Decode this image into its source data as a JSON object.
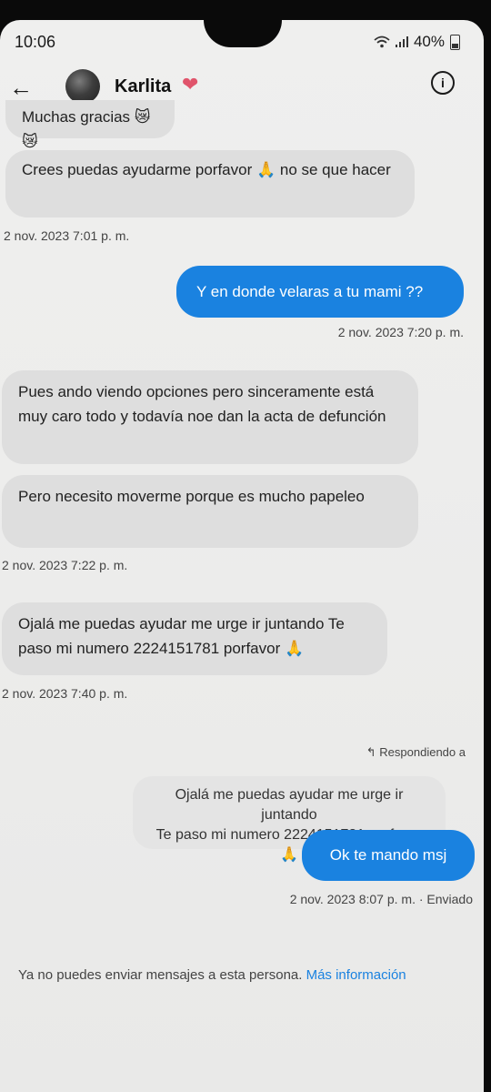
{
  "status_bar": {
    "time": "10:06",
    "battery": "40%"
  },
  "header": {
    "contact_name": "Karlita",
    "heart": "❤",
    "back_icon": "←",
    "info_icon": "i"
  },
  "messages": [
    {
      "dir": "in",
      "text": "Muchas gracias 😿😿"
    },
    {
      "dir": "in",
      "text": "Crees puedas ayudarme porfavor 🙏 no se que hacer"
    },
    {
      "dir": "time",
      "text": "2 nov. 2023 7:01 p. m."
    },
    {
      "dir": "out",
      "text": "Y en donde velaras a tu mami ??"
    },
    {
      "dir": "time",
      "text": "2 nov. 2023 7:20 p. m."
    },
    {
      "dir": "in",
      "text": "Pues ando viendo opciones pero sinceramente está muy caro todo y todavía noe dan la acta de defunción"
    },
    {
      "dir": "in",
      "text": "Pero necesito moverme porque es mucho papeleo"
    },
    {
      "dir": "time",
      "text": "2 nov. 2023 7:22 p. m."
    },
    {
      "dir": "in",
      "text": "Ojalá me puedas ayudar me urge ir juntando Te paso mi numero 2224151781 porfavor 🙏"
    },
    {
      "dir": "time",
      "text": "2 nov. 2023 7:40 p. m."
    }
  ],
  "reply": {
    "label": "Respondiendo a",
    "quoted_line1": "Ojalá me puedas ayudar me urge ir juntando",
    "quoted_line2": "Te paso mi numero 2224151781 porfavor 🙏",
    "text": "Ok te mando msj",
    "time": "2 nov. 2023 8:07 p. m. · Enviado"
  },
  "footer": {
    "note": "Ya no puedes enviar mensajes a esta persona.",
    "link": "Más información"
  },
  "colors": {
    "outgoing_bubble": "#1a82e0",
    "incoming_bubble": "#dedede",
    "link": "#1a82e0"
  }
}
